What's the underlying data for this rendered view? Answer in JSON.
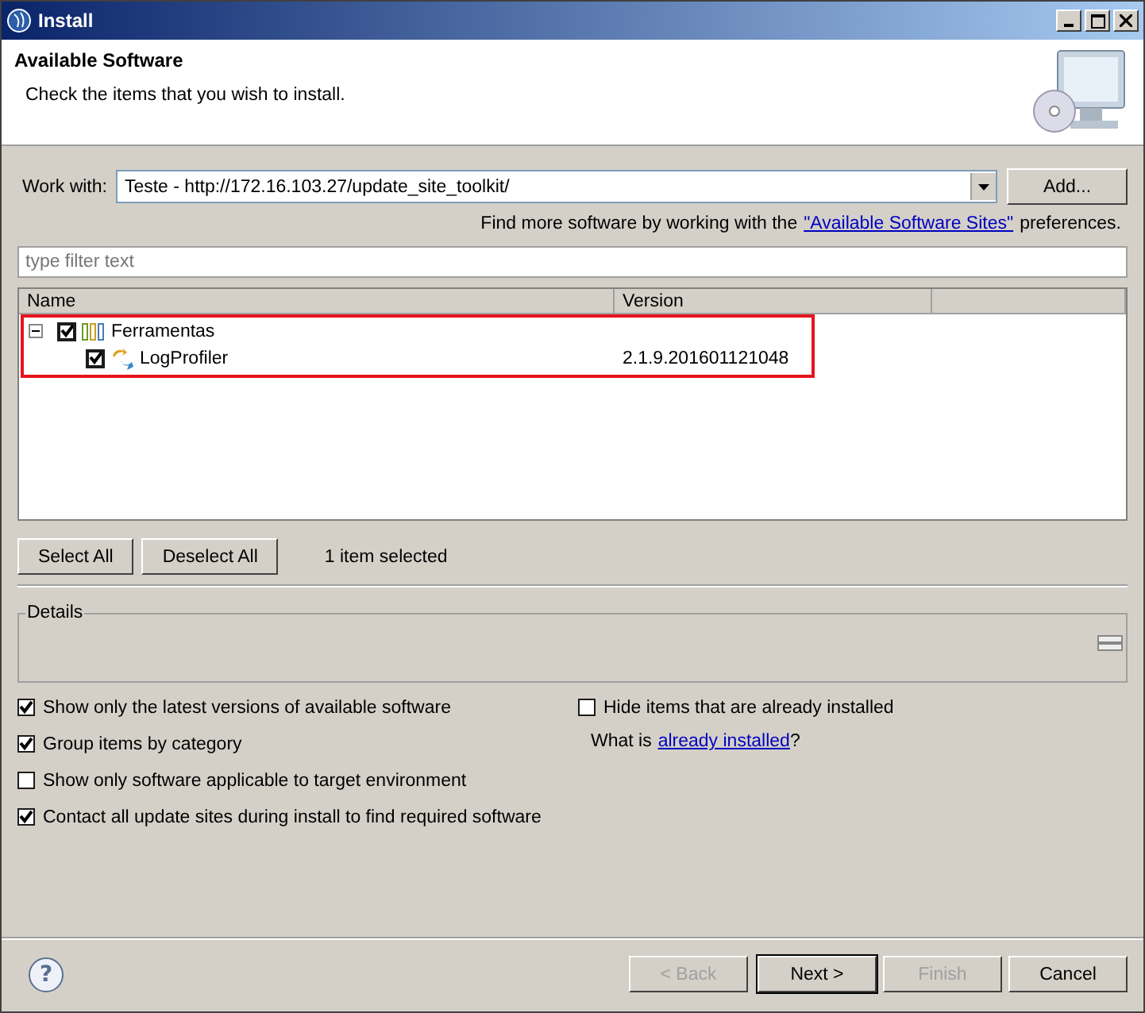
{
  "window": {
    "title": "Install"
  },
  "header": {
    "title": "Available Software",
    "subtitle": "Check the items that you wish to install."
  },
  "work_with": {
    "label": "Work with:",
    "value": "Teste - http://172.16.103.27/update_site_toolkit/",
    "add_button": "Add..."
  },
  "find_more": {
    "before": "Find more software by working with the",
    "link": "\"Available Software Sites\"",
    "after": "preferences."
  },
  "filter": {
    "placeholder": "type filter text"
  },
  "tree": {
    "columns": [
      "Name",
      "Version"
    ],
    "rows": [
      {
        "name": "Ferramentas",
        "version": "",
        "checked": true,
        "expanded": true,
        "kind": "category",
        "highlighted": true,
        "children": [
          {
            "name": "LogProfiler",
            "version": "2.1.9.201601121048",
            "checked": true,
            "kind": "feature"
          }
        ]
      }
    ]
  },
  "selection_buttons": [
    "Select All",
    "Deselect All"
  ],
  "selection_status": "1 item selected",
  "details": {
    "legend": "Details"
  },
  "options": [
    {
      "label": "Show only the latest versions of available software",
      "checked": true
    },
    {
      "label": "Group items by category",
      "checked": true
    },
    {
      "label": "Show only software applicable to target environment",
      "checked": false
    },
    {
      "label": "Contact all update sites during install to find required software",
      "checked": true
    }
  ],
  "right_options": {
    "hide_installed": {
      "label": "Hide items that are already installed",
      "checked": false
    },
    "what_is": {
      "before": "What is",
      "link": "already installed",
      "after": "?"
    }
  },
  "help_button": "?",
  "footer_buttons": [
    {
      "label": "< Back",
      "disabled": true,
      "default": false
    },
    {
      "label": "Next >",
      "disabled": false,
      "default": true
    },
    {
      "label": "Finish",
      "disabled": true,
      "default": false
    },
    {
      "label": "Cancel",
      "disabled": false,
      "default": false
    }
  ]
}
